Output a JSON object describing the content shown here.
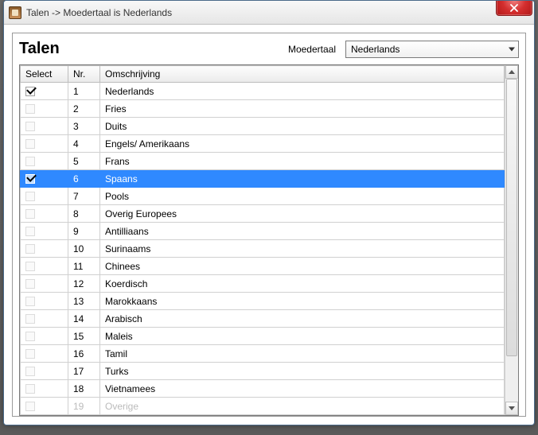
{
  "window": {
    "title": "Talen -> Moedertaal is Nederlands"
  },
  "header": {
    "heading": "Talen",
    "moedertaal_label": "Moedertaal",
    "dropdown_value": "Nederlands"
  },
  "table": {
    "columns": {
      "select": "Select",
      "nr": "Nr.",
      "omschrijving": "Omschrijving"
    },
    "rows": [
      {
        "nr": "1",
        "omschrijving": "Nederlands",
        "checked": true,
        "selected": false
      },
      {
        "nr": "2",
        "omschrijving": "Fries",
        "checked": false,
        "selected": false
      },
      {
        "nr": "3",
        "omschrijving": "Duits",
        "checked": false,
        "selected": false
      },
      {
        "nr": "4",
        "omschrijving": "Engels/ Amerikaans",
        "checked": false,
        "selected": false
      },
      {
        "nr": "5",
        "omschrijving": "Frans",
        "checked": false,
        "selected": false
      },
      {
        "nr": "6",
        "omschrijving": "Spaans",
        "checked": true,
        "selected": true
      },
      {
        "nr": "7",
        "omschrijving": "Pools",
        "checked": false,
        "selected": false
      },
      {
        "nr": "8",
        "omschrijving": "Overig Europees",
        "checked": false,
        "selected": false
      },
      {
        "nr": "9",
        "omschrijving": "Antilliaans",
        "checked": false,
        "selected": false
      },
      {
        "nr": "10",
        "omschrijving": "Surinaams",
        "checked": false,
        "selected": false
      },
      {
        "nr": "11",
        "omschrijving": "Chinees",
        "checked": false,
        "selected": false
      },
      {
        "nr": "12",
        "omschrijving": "Koerdisch",
        "checked": false,
        "selected": false
      },
      {
        "nr": "13",
        "omschrijving": "Marokkaans",
        "checked": false,
        "selected": false
      },
      {
        "nr": "14",
        "omschrijving": "Arabisch",
        "checked": false,
        "selected": false
      },
      {
        "nr": "15",
        "omschrijving": "Maleis",
        "checked": false,
        "selected": false
      },
      {
        "nr": "16",
        "omschrijving": "Tamil",
        "checked": false,
        "selected": false
      },
      {
        "nr": "17",
        "omschrijving": "Turks",
        "checked": false,
        "selected": false
      },
      {
        "nr": "18",
        "omschrijving": "Vietnamees",
        "checked": false,
        "selected": false
      },
      {
        "nr": "19",
        "omschrijving": "Overige",
        "checked": false,
        "selected": false,
        "clipped": true
      }
    ]
  },
  "scrollbar": {
    "thumb_top_pct": 0,
    "thumb_height_pct": 86
  }
}
